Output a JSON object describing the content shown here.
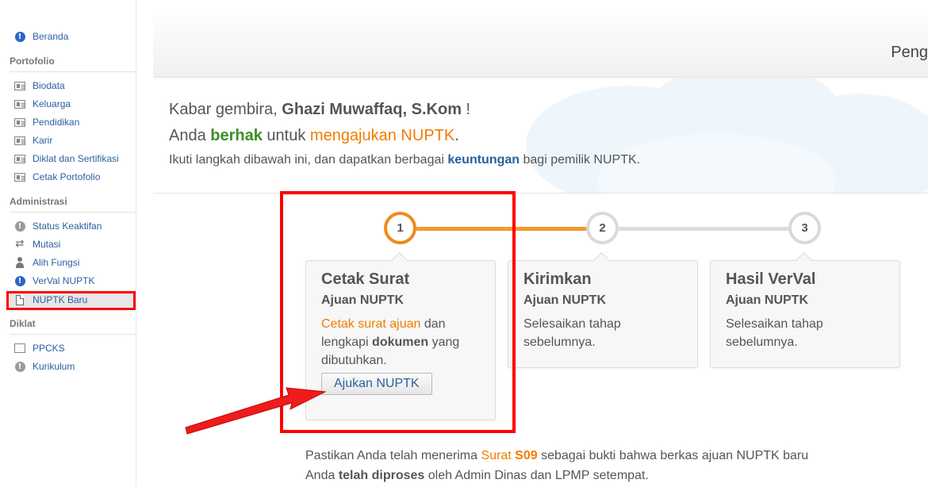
{
  "sidebar": {
    "beranda": "Beranda",
    "portofolio_title": "Portofolio",
    "portofolio": [
      "Biodata",
      "Keluarga",
      "Pendidikan",
      "Karir",
      "Diklat dan Sertifikasi",
      "Cetak Portofolio"
    ],
    "administrasi_title": "Administrasi",
    "administrasi": [
      "Status Keaktifan",
      "Mutasi",
      "Alih Fungsi",
      "VerVal NUPTK",
      "NUPTK Baru"
    ],
    "diklat_title": "Diklat",
    "diklat": [
      "PPCKS",
      "Kurikulum"
    ]
  },
  "header": {
    "title": "Peng"
  },
  "hero": {
    "greet_prefix": "Kabar gembira, ",
    "name": "Ghazi Muwaffaq, S.Kom",
    "greet_suffix": " !",
    "line2_a": "Anda ",
    "line2_berhak": "berhak",
    "line2_b": " untuk ",
    "line2_mengajukan": "mengajukan NUPTK",
    "line2_c": ".",
    "line3_a": "Ikuti langkah dibawah ini, dan dapatkan berbagai ",
    "line3_keuntungan": "keuntungan",
    "line3_b": " bagi pemilik NUPTK."
  },
  "steps": [
    {
      "number": "1",
      "title": "Cetak Surat",
      "subtitle": "Ajuan NUPTK",
      "desc_link": "Cetak surat ajuan",
      "desc_a": " dan lengkapi ",
      "desc_bold": "dokumen",
      "desc_b": " yang dibutuhkan.",
      "button": "Ajukan NUPTK"
    },
    {
      "number": "2",
      "title": "Kirimkan",
      "subtitle": "Ajuan NUPTK",
      "desc": "Selesaikan tahap sebelumnya."
    },
    {
      "number": "3",
      "title": "Hasil VerVal",
      "subtitle": "Ajuan NUPTK",
      "desc": "Selesaikan tahap sebelumnya."
    }
  ],
  "note": {
    "a": "Pastikan Anda telah menerima ",
    "surat": "Surat ",
    "s09": "S09",
    "b": " sebagai bukti bahwa berkas ajuan NUPTK baru",
    "c": "Anda ",
    "diproses": "telah diproses",
    "d": " oleh Admin Dinas dan LPMP setempat."
  },
  "colors": {
    "accent_orange": "#f07d00",
    "link_blue": "#2a5f9e",
    "highlight_red": "#ff0000",
    "success_green": "#3b8f23"
  }
}
